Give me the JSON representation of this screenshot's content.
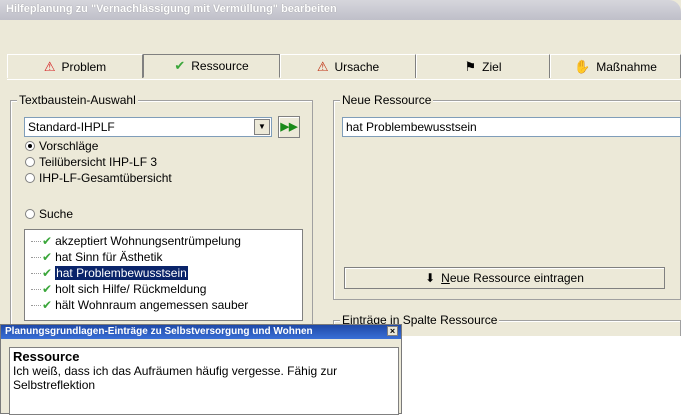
{
  "window": {
    "title": "Hilfeplanung zu \"Vernachlässigung mit Vermüllung\" bearbeiten"
  },
  "tabs": [
    {
      "label": "Problem",
      "icon": "warning-icon"
    },
    {
      "label": "Ressource",
      "icon": "checkmark-icon"
    },
    {
      "label": "Ursache",
      "icon": "cause-icon"
    },
    {
      "label": "Ziel",
      "icon": "finish-flag-icon"
    },
    {
      "label": "Maßnahme",
      "icon": "hand-icon"
    }
  ],
  "selection": {
    "legend": "Textbaustein-Auswahl",
    "dropdown_value": "Standard-IHPLF",
    "go_label": "▶▶",
    "radios": [
      {
        "label": "Vorschläge",
        "checked": true
      },
      {
        "label": "Teilübersicht IHP-LF 3",
        "checked": false
      },
      {
        "label": "IHP-LF-Gesamtübersicht",
        "checked": false
      }
    ],
    "search_label": "Suche",
    "items": [
      {
        "label": "akzeptiert Wohnungsentrümpelung",
        "selected": false
      },
      {
        "label": "hat Sinn für Ästhetik",
        "selected": false
      },
      {
        "label": "hat Problembewusstsein",
        "selected": true
      },
      {
        "label": "holt sich Hilfe/ Rückmeldung",
        "selected": false
      },
      {
        "label": "hält Wohnraum angemessen sauber",
        "selected": false
      }
    ]
  },
  "new_resource": {
    "legend": "Neue Ressource",
    "value": "hat Problembewusstsein",
    "button_arrow": "⬇",
    "button_mnemonic": "N",
    "button_rest": "eue Ressource eintragen"
  },
  "entries": {
    "legend": "Einträge in Spalte Ressource"
  },
  "popup": {
    "title": "Planungsgrundlagen-Einträge zu Selbstversorgung und Wohnen",
    "close": "×",
    "heading": "Ressource",
    "text": "Ich weiß, dass ich das Aufräumen häufig vergesse. Fähig zur Selbstreflektion"
  }
}
